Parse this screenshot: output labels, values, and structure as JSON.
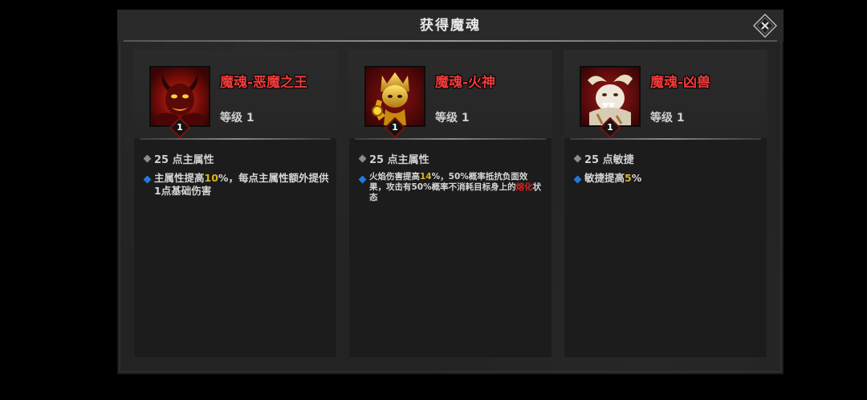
{
  "dialog": {
    "title": "获得魔魂",
    "close_icon": "close-x-icon"
  },
  "cards": [
    {
      "name": "魔魂-恶魔之王",
      "level_label": "等级 1",
      "badge": "1",
      "portrait_icon": "demon-king-portrait",
      "stat": "25 点主属性",
      "desc": {
        "a": "主属性提高",
        "b": "10",
        "c": "%，每点主属性额外提供1点基础伤害"
      }
    },
    {
      "name": "魔魂-火神",
      "level_label": "等级 1",
      "badge": "1",
      "portrait_icon": "fire-god-portrait",
      "stat": "25 点主属性",
      "desc": {
        "a": "火焰伤害提高",
        "b": "14",
        "c": "%，50%概率抵抗负面效果，攻击有50%概率不消耗目标身上的",
        "d": "熔化",
        "e": "状态"
      }
    },
    {
      "name": "魔魂-凶兽",
      "level_label": "等级 1",
      "badge": "1",
      "portrait_icon": "beast-portrait",
      "stat": "25 点敏捷",
      "desc": {
        "a": "敏捷提高",
        "b": "5",
        "c": "%"
      }
    }
  ],
  "colors": {
    "name_red": "#ef3b3b",
    "highlight_yellow": "#d8b520",
    "highlight_red": "#d32020",
    "bullet_blue": "#1f7ae0"
  }
}
